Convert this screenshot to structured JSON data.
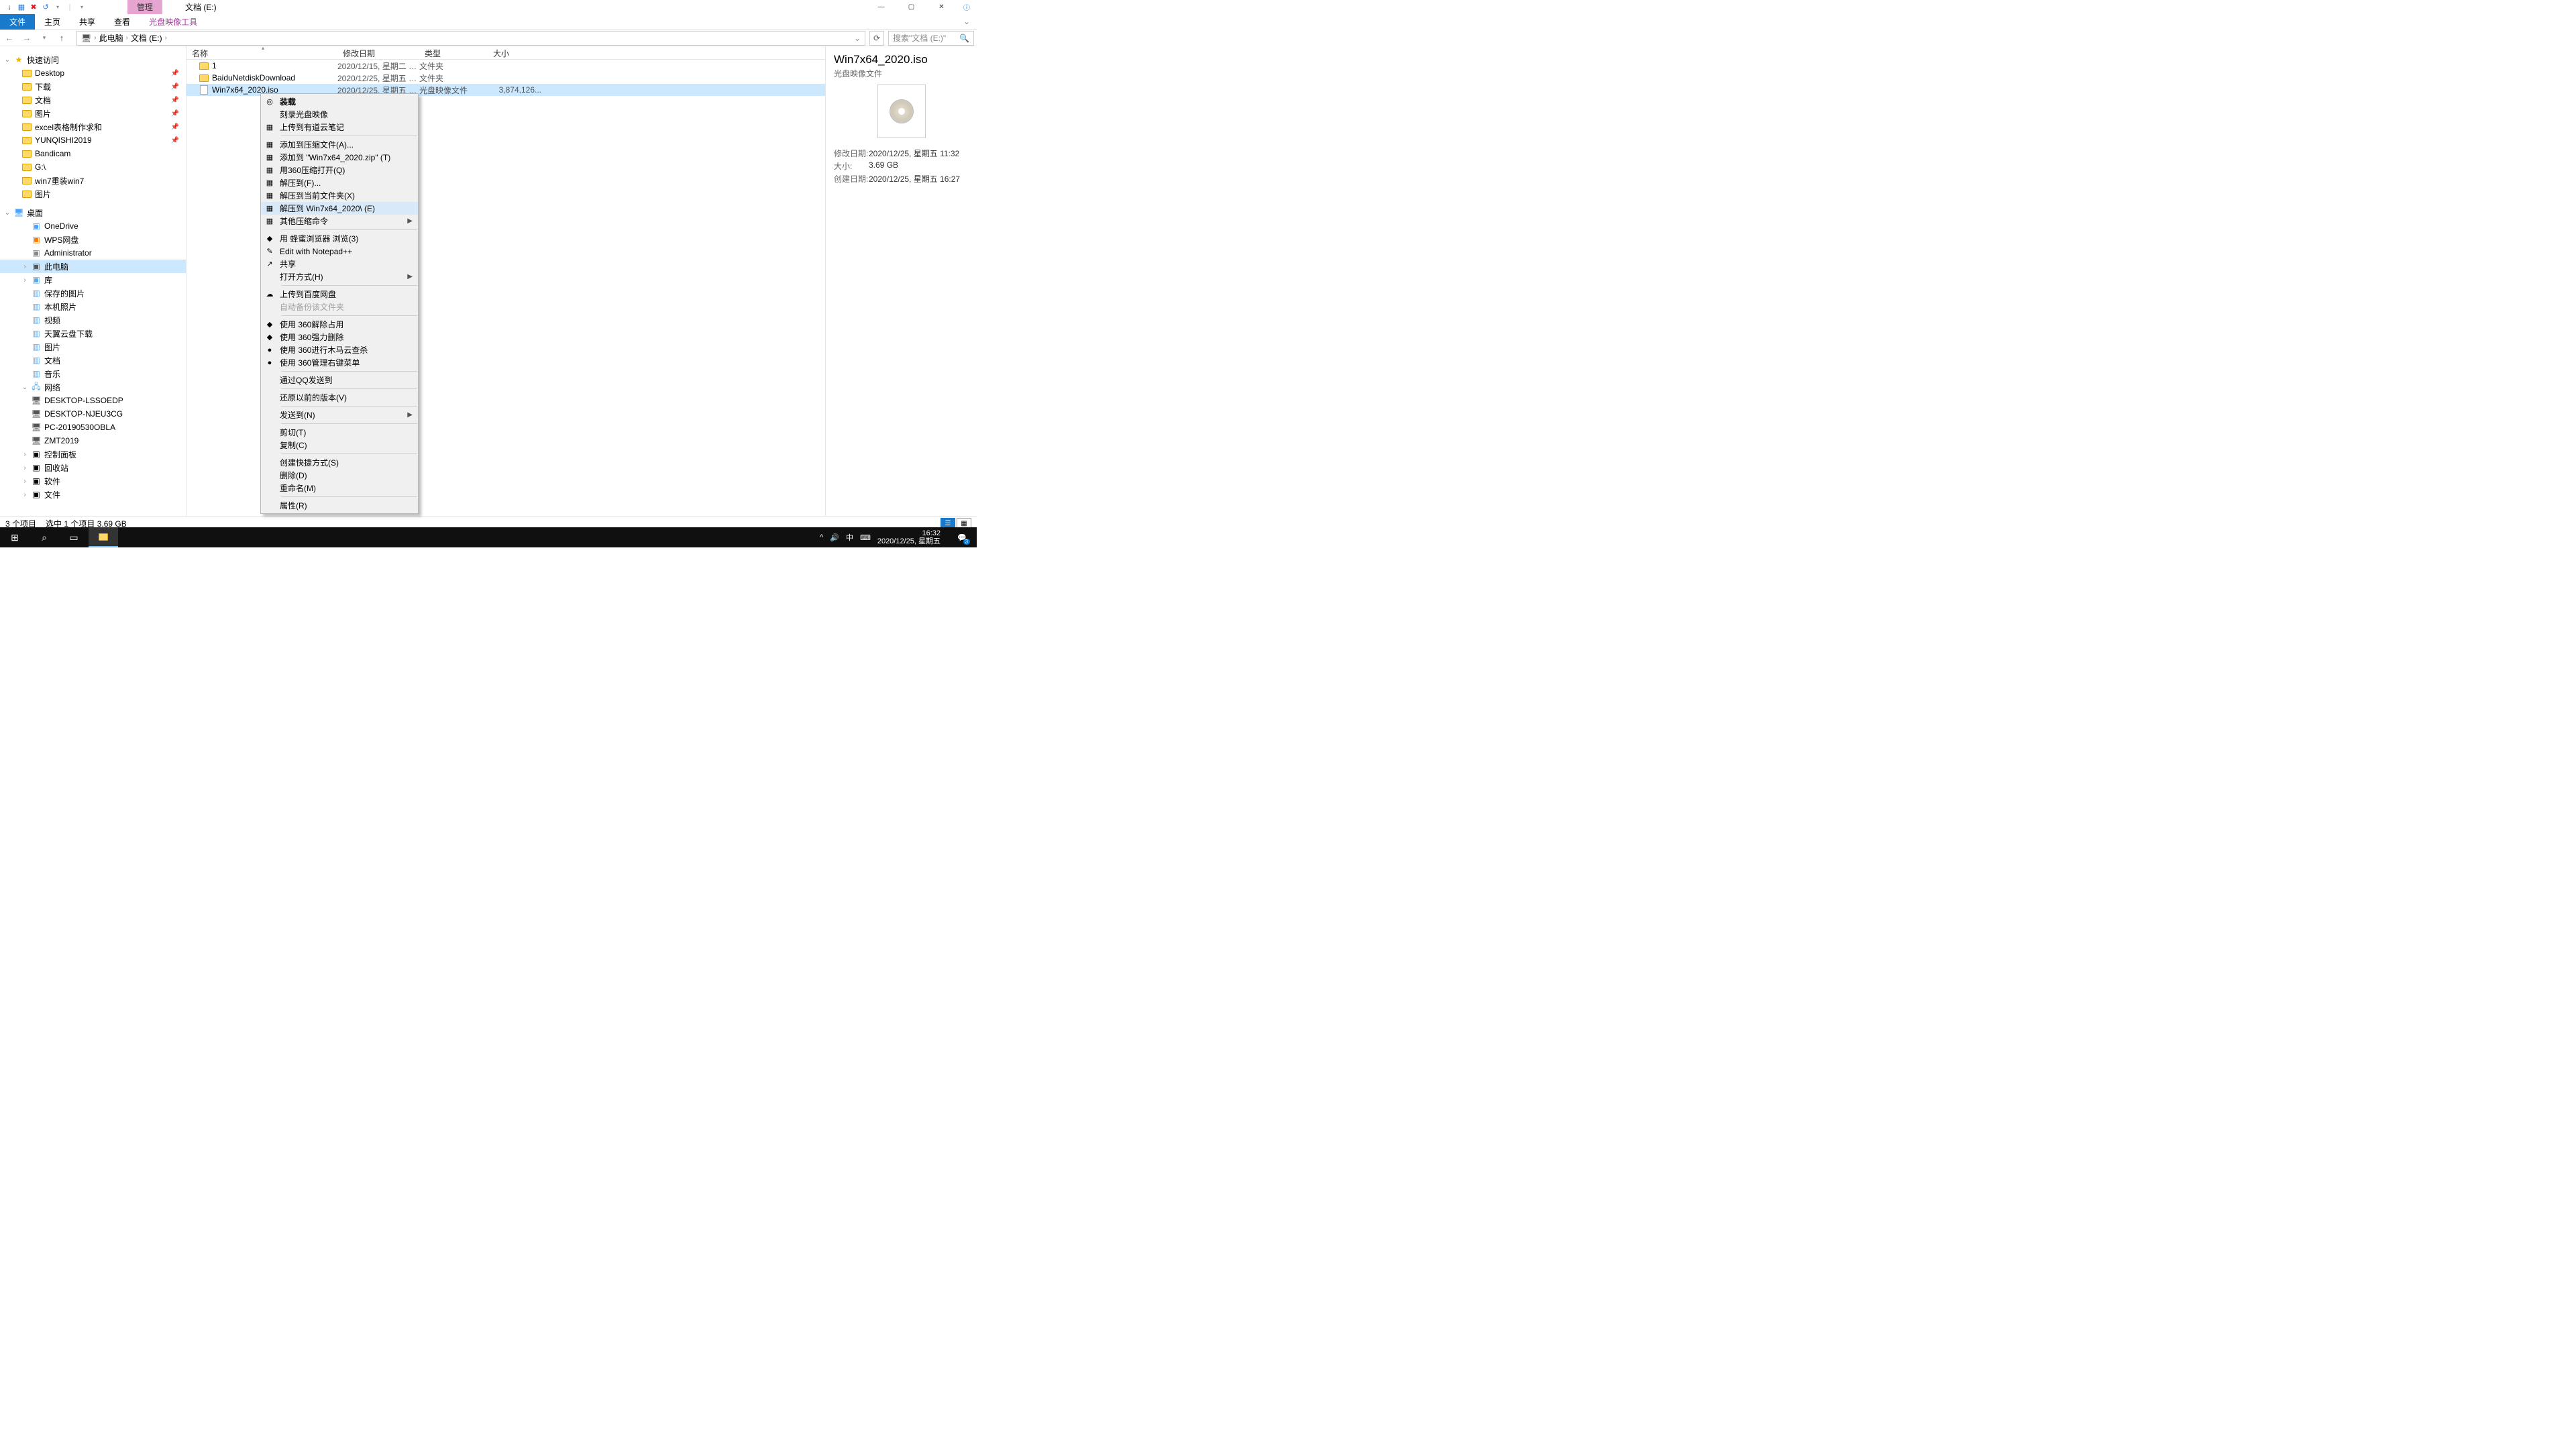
{
  "titlebar": {
    "contextualTab": "管理",
    "windowTitle": "文档 (E:)",
    "qat": [
      "↓",
      "▦",
      "✖",
      "↺",
      "▾",
      "|",
      "▾"
    ]
  },
  "ribbon": {
    "file": "文件",
    "tabs": [
      "主页",
      "共享",
      "查看"
    ],
    "contextual": "光盘映像工具"
  },
  "addressbar": {
    "segments": [
      "此电脑",
      "文档 (E:)"
    ],
    "searchPlaceholder": "搜索\"文档 (E:)\""
  },
  "nav": {
    "quickAccess": "快速访问",
    "quickItems": [
      {
        "label": "Desktop",
        "pin": true,
        "cls": "mon"
      },
      {
        "label": "下载",
        "pin": true,
        "cls": "blue-f"
      },
      {
        "label": "文档",
        "pin": true,
        "cls": "blue-f"
      },
      {
        "label": "图片",
        "pin": true,
        "cls": "blue-f"
      },
      {
        "label": "excel表格制作求和",
        "pin": true,
        "cls": ""
      },
      {
        "label": "YUNQISHI2019",
        "pin": true,
        "cls": ""
      },
      {
        "label": "Bandicam",
        "cls": ""
      },
      {
        "label": "G:\\",
        "cls": ""
      },
      {
        "label": "win7重装win7",
        "cls": ""
      },
      {
        "label": "图片",
        "cls": ""
      }
    ],
    "desktop": "桌面",
    "desktopItems": [
      {
        "label": "OneDrive",
        "cls": "cloud"
      },
      {
        "label": "WPS网盘",
        "cls": "wps"
      },
      {
        "label": "Administrator",
        "cls": "usr"
      },
      {
        "label": "此电脑",
        "cls": "pc",
        "sel": true
      },
      {
        "label": "库",
        "cls": "lib"
      }
    ],
    "libItems": [
      "保存的图片",
      "本机照片",
      "视频",
      "天翼云盘下载",
      "图片",
      "文档",
      "音乐"
    ],
    "network": "网络",
    "netItems": [
      "DESKTOP-LSSOEDP",
      "DESKTOP-NJEU3CG",
      "PC-20190530OBLA",
      "ZMT2019"
    ],
    "others": [
      "控制面板",
      "回收站",
      "软件",
      "文件"
    ]
  },
  "columns": {
    "name": "名称",
    "date": "修改日期",
    "type": "类型",
    "size": "大小"
  },
  "files": [
    {
      "name": "1",
      "date": "2020/12/15, 星期二 1...",
      "type": "文件夹",
      "size": "",
      "kind": "folder"
    },
    {
      "name": "BaiduNetdiskDownload",
      "date": "2020/12/25, 星期五 1...",
      "type": "文件夹",
      "size": "",
      "kind": "folder"
    },
    {
      "name": "Win7x64_2020.iso",
      "date": "2020/12/25, 星期五 1...",
      "type": "光盘映像文件",
      "size": "3,874,126...",
      "kind": "iso",
      "sel": true
    }
  ],
  "contextMenu": {
    "groups": [
      [
        {
          "l": "装载",
          "def": true,
          "ico": "◎"
        },
        {
          "l": "刻录光盘映像"
        },
        {
          "l": "上传到有道云笔记",
          "ico": "▦",
          "blue": true
        }
      ],
      [
        {
          "l": "添加到压缩文件(A)...",
          "ico": "▦"
        },
        {
          "l": "添加到 \"Win7x64_2020.zip\" (T)",
          "ico": "▦"
        },
        {
          "l": "用360压缩打开(Q)",
          "ico": "▦"
        },
        {
          "l": "解压到(F)...",
          "ico": "▦"
        },
        {
          "l": "解压到当前文件夹(X)",
          "ico": "▦"
        },
        {
          "l": "解压到 Win7x64_2020\\ (E)",
          "ico": "▦",
          "hl": true
        },
        {
          "l": "其他压缩命令",
          "ico": "▦",
          "sub": true
        }
      ],
      [
        {
          "l": "用 蜂蜜浏览器 浏览(3)",
          "ico": "◆"
        },
        {
          "l": "Edit with Notepad++",
          "ico": "✎"
        },
        {
          "l": "共享",
          "ico": "↗"
        },
        {
          "l": "打开方式(H)",
          "sub": true
        }
      ],
      [
        {
          "l": "上传到百度网盘",
          "ico": "☁"
        },
        {
          "l": "自动备份该文件夹",
          "dis": true
        }
      ],
      [
        {
          "l": "使用 360解除占用",
          "ico": "◆"
        },
        {
          "l": "使用 360强力删除",
          "ico": "◆"
        },
        {
          "l": "使用 360进行木马云查杀",
          "ico": "●"
        },
        {
          "l": "使用 360管理右键菜单",
          "ico": "●"
        }
      ],
      [
        {
          "l": "通过QQ发送到"
        }
      ],
      [
        {
          "l": "还原以前的版本(V)"
        }
      ],
      [
        {
          "l": "发送到(N)",
          "sub": true
        }
      ],
      [
        {
          "l": "剪切(T)"
        },
        {
          "l": "复制(C)"
        }
      ],
      [
        {
          "l": "创建快捷方式(S)"
        },
        {
          "l": "删除(D)"
        },
        {
          "l": "重命名(M)"
        }
      ],
      [
        {
          "l": "属性(R)"
        }
      ]
    ]
  },
  "details": {
    "title": "Win7x64_2020.iso",
    "subtitle": "光盘映像文件",
    "meta": [
      {
        "k": "修改日期:",
        "v": "2020/12/25, 星期五 11:32"
      },
      {
        "k": "大小:",
        "v": "3.69 GB"
      },
      {
        "k": "创建日期:",
        "v": "2020/12/25, 星期五 16:27"
      }
    ]
  },
  "status": {
    "count": "3 个项目",
    "sel": "选中 1 个项目  3.69 GB"
  },
  "taskbar": {
    "tray": [
      "^",
      "🔊",
      "中",
      "⌨"
    ],
    "time": "16:32",
    "date": "2020/12/25, 星期五",
    "notif": "3"
  }
}
